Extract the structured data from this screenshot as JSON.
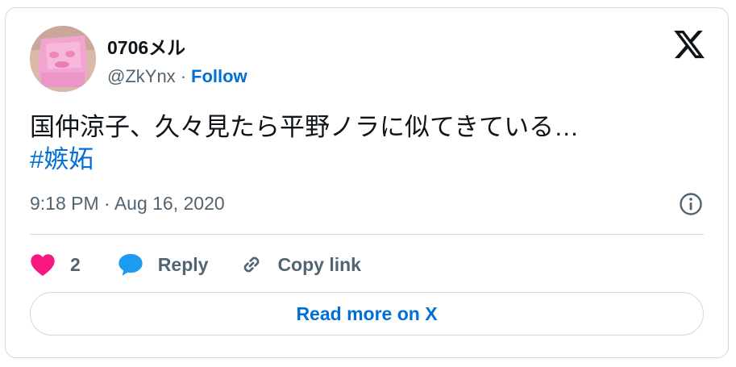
{
  "author": {
    "display_name": "0706メル",
    "handle": "@ZkYnx",
    "separator": "·",
    "follow_label": "Follow"
  },
  "tweet": {
    "text": "国仲涼子、久々見たら平野ノラに似てきている…",
    "hashtag": "#嫉妬",
    "timestamp": "9:18 PM · Aug 16, 2020"
  },
  "actions": {
    "like_count": "2",
    "reply_label": "Reply",
    "copy_link_label": "Copy link"
  },
  "read_more_label": "Read more on X",
  "colors": {
    "link_blue": "#006fd6",
    "like_pink": "#f91880",
    "reply_blue": "#1d9bf0",
    "text_dark": "#0f1419",
    "text_gray": "#536471",
    "border": "#cfd9de"
  },
  "icons": {
    "logo": "x-logo-icon",
    "like": "heart-icon",
    "reply": "speech-bubble-icon",
    "copy": "link-icon",
    "info": "info-icon"
  }
}
